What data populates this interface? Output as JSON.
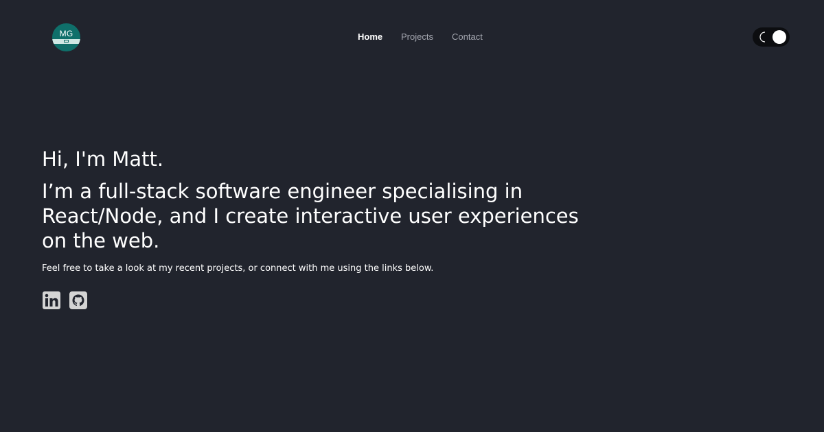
{
  "logo": {
    "initials": "MG",
    "icon": "laptop-icon"
  },
  "nav": {
    "items": [
      {
        "label": "Home",
        "active": true
      },
      {
        "label": "Projects",
        "active": false
      },
      {
        "label": "Contact",
        "active": false
      }
    ]
  },
  "theme_toggle": {
    "icon": "moon-icon",
    "state": "dark"
  },
  "hero": {
    "greeting": "Hi, I'm Matt.",
    "tagline": "I’m a full-stack software engineer specialising in React/Node, and I create interactive user experiences on the web.",
    "description": "Feel free to take a look at my recent projects, or connect with me using the links below."
  },
  "social": [
    {
      "icon": "linkedin-icon"
    },
    {
      "icon": "github-icon"
    }
  ],
  "colors": {
    "background": "#21242d",
    "text": "#ffffff",
    "nav_inactive": "#a4a7b0",
    "logo_bg": "#0f6f6a",
    "toggle_bg": "#0c0d10",
    "social_icon": "#d4d4d4"
  }
}
